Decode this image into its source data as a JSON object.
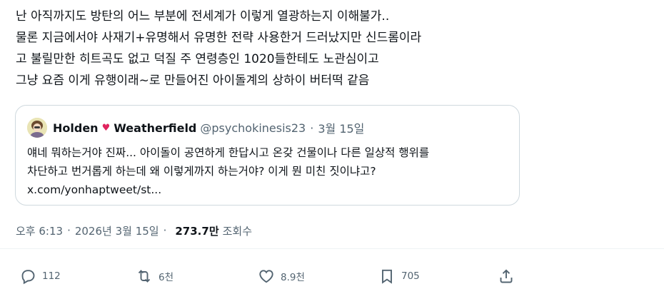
{
  "post": {
    "lines": [
      "난 아직까지도 방탄의 어느 부분에 전세계가 이렇게 열광하는지 이해불가..",
      "물론 지금에서야 사재기+유명해서 유명한 전략 사용한거 드러났지만 신드롬이라",
      "고 불릴만한 히트곡도 없고 덕질 주 연령층인 1020들한테도 노관심이고",
      "그냥 요즘 이게 유행이래~로 만들어진 아이돌계의 상하이 버터떡 같음"
    ]
  },
  "quote": {
    "name_first": "Holden",
    "heart": "♥",
    "name_last": "Weatherfield",
    "handle": "@psychokinesis23",
    "separator": "·",
    "date": "3월 15일",
    "lines": [
      "얘네 뭐하는거야 진짜... 아이돌이 공연하게 한답시고 온갖 건물이나 다른 일상적 행위를",
      "차단하고 번거롭게 하는데 왜 이렇게까지 하는거야? 이게 뭔 미친 짓이냐고?",
      "x.com/yonhaptweet/st..."
    ],
    "heart_color": "#e0245e"
  },
  "meta": {
    "time": "오후 6:13",
    "separator1": "·",
    "date": "2026년 3월 15일",
    "separator2": "·",
    "views": "273.7만",
    "views_label": "조회수"
  },
  "actions": {
    "reply": {
      "icon": "reply-icon",
      "count": "112"
    },
    "retweet": {
      "icon": "retweet-icon",
      "count": "6천"
    },
    "like": {
      "icon": "heart-icon",
      "count": "8.9천"
    },
    "bookmark": {
      "icon": "bookmark-icon",
      "count": "705"
    },
    "share": {
      "icon": "share-icon"
    }
  },
  "colors": {
    "text": "#0f1419",
    "secondary": "#536471",
    "border": "#cfd9de"
  }
}
